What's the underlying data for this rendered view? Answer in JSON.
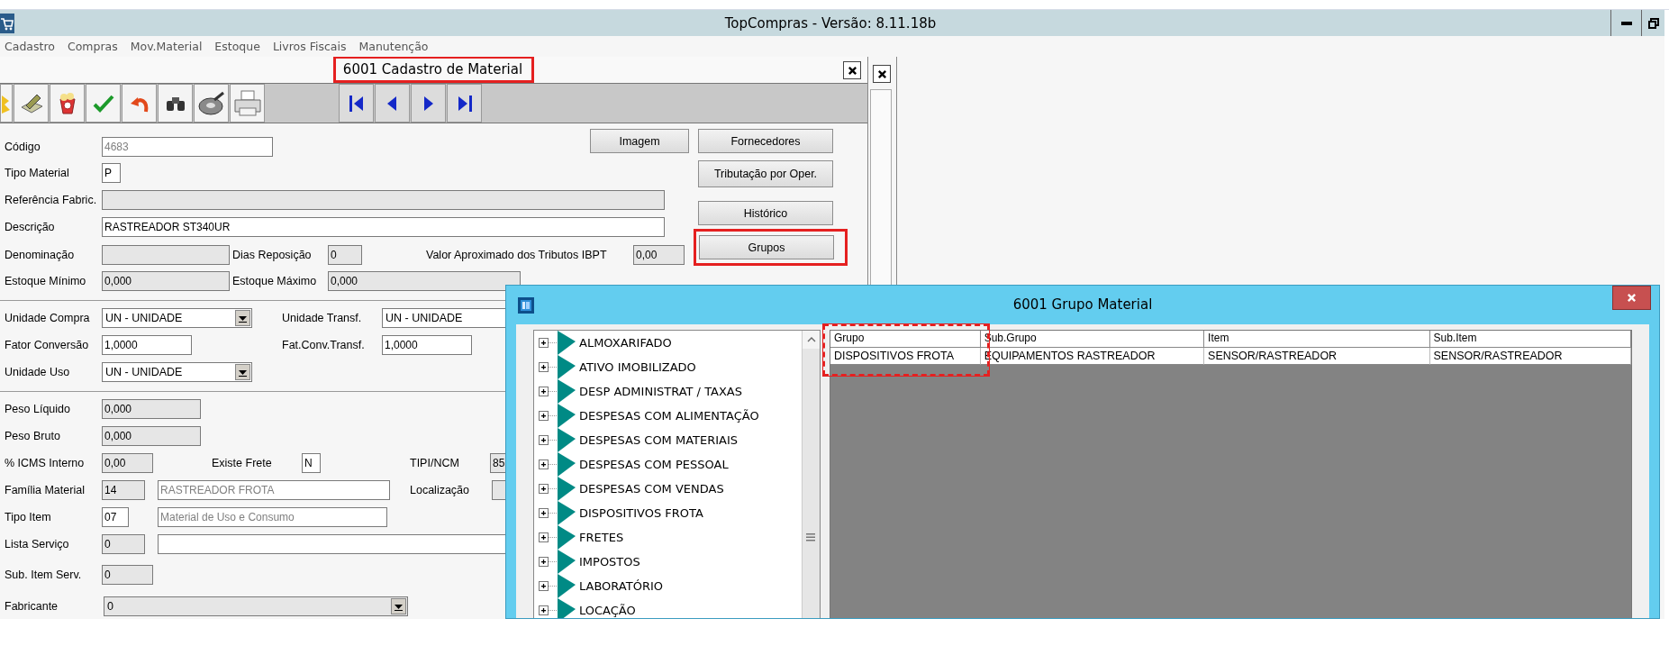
{
  "app": {
    "title": "TopCompras - Versão: 8.11.18b"
  },
  "menu": [
    "Cadastro",
    "Compras",
    "Mov.Material",
    "Estoque",
    "Livros Fiscais",
    "Manutenção"
  ],
  "material_window": {
    "title": "6001 Cadastro de Material",
    "title_highlighted": true,
    "toolbar": [
      {
        "kind": "sparkle"
      },
      {
        "kind": "edit"
      },
      {
        "kind": "basket"
      },
      {
        "kind": "confirm"
      },
      {
        "kind": "undo"
      },
      {
        "kind": "search"
      },
      {
        "kind": "disc"
      },
      {
        "kind": "print"
      }
    ],
    "navigation": [
      {
        "kind": "first"
      },
      {
        "kind": "previous"
      },
      {
        "kind": "next"
      },
      {
        "kind": "last"
      }
    ],
    "buttons": [
      {
        "label": "Imagem",
        "highlighted": false
      },
      {
        "label": "Fornecedores",
        "highlighted": false
      },
      {
        "label": "Tributação por Oper.",
        "highlighted": false
      },
      {
        "label": "Histórico",
        "highlighted": false
      },
      {
        "label": "Grupos",
        "highlighted": true
      }
    ],
    "rows": [
      {
        "kind": "fields",
        "items": [
          {
            "kind": "label",
            "text": "Código"
          },
          {
            "kind": "field",
            "value": "4683",
            "readonly": false,
            "dimmed": true
          }
        ]
      },
      {
        "kind": "fields",
        "items": [
          {
            "kind": "label",
            "text": "Tipo Material"
          },
          {
            "kind": "field",
            "value": "P",
            "readonly": false,
            "dimmed": false
          }
        ]
      },
      {
        "kind": "fields",
        "items": [
          {
            "kind": "label",
            "text": "Referência Fabric."
          },
          {
            "kind": "field",
            "readonly": true
          }
        ]
      },
      {
        "kind": "fields",
        "items": [
          {
            "kind": "label",
            "text": "Descrição"
          },
          {
            "kind": "field",
            "value": "RASTREADOR ST340UR",
            "readonly": false,
            "dimmed": false
          }
        ]
      },
      {
        "kind": "fields",
        "items": [
          {
            "kind": "label",
            "text": "Denominação"
          },
          {
            "kind": "field",
            "readonly": true
          },
          {
            "kind": "label",
            "text": "Dias Reposição"
          },
          {
            "kind": "field",
            "value": "0",
            "readonly": true,
            "dimmed": false
          },
          {
            "kind": "label",
            "text": "Valor Aproximado dos Tributos IBPT"
          },
          {
            "kind": "field",
            "value": "0,00",
            "readonly": true,
            "dimmed": false
          }
        ]
      },
      {
        "kind": "fields",
        "items": [
          {
            "kind": "label",
            "text": "Estoque Mínimo"
          },
          {
            "kind": "field",
            "value": "0,000",
            "readonly": true,
            "dimmed": false
          },
          {
            "kind": "label",
            "text": "Estoque Máximo"
          },
          {
            "kind": "field",
            "value": "0,000",
            "readonly": true,
            "dimmed": false
          }
        ]
      },
      {
        "kind": "divider"
      },
      {
        "kind": "fields",
        "items": [
          {
            "kind": "label",
            "text": "Unidade Compra"
          },
          {
            "kind": "dropdown",
            "value": "UN - UNIDADE",
            "readonly": false,
            "dimmed": false
          },
          {
            "kind": "label",
            "text": "Unidade Transf."
          },
          {
            "kind": "dropdown",
            "value": "UN - UNIDADE",
            "readonly": false,
            "dimmed": false
          }
        ]
      },
      {
        "kind": "fields",
        "items": [
          {
            "kind": "label",
            "text": "Fator Conversão"
          },
          {
            "kind": "field",
            "value": "1,0000",
            "readonly": false,
            "dimmed": false
          },
          {
            "kind": "label",
            "text": "Fat.Conv.Transf."
          },
          {
            "kind": "field",
            "value": "1,0000",
            "readonly": false,
            "dimmed": false
          }
        ]
      },
      {
        "kind": "fields",
        "items": [
          {
            "kind": "label",
            "text": "Unidade Uso"
          },
          {
            "kind": "dropdown",
            "value": "UN - UNIDADE",
            "readonly": false,
            "dimmed": false
          }
        ]
      },
      {
        "kind": "divider"
      },
      {
        "kind": "fields",
        "items": [
          {
            "kind": "label",
            "text": "Peso Líquido"
          },
          {
            "kind": "field",
            "value": "0,000",
            "readonly": true,
            "dimmed": false
          }
        ]
      },
      {
        "kind": "fields",
        "items": [
          {
            "kind": "label",
            "text": "Peso Bruto"
          },
          {
            "kind": "field",
            "value": "0,000",
            "readonly": true,
            "dimmed": false
          }
        ]
      },
      {
        "kind": "fields",
        "items": [
          {
            "kind": "label",
            "text": "% ICMS Interno"
          },
          {
            "kind": "field",
            "value": "0,00",
            "readonly": true,
            "dimmed": false
          },
          {
            "kind": "label",
            "text": "Existe Frete"
          },
          {
            "kind": "field",
            "value": "N",
            "readonly": false,
            "dimmed": false
          },
          {
            "kind": "label",
            "text": "TIPI/NCM"
          },
          {
            "kind": "field",
            "value": "85",
            "readonly": true,
            "dimmed": false
          }
        ]
      },
      {
        "kind": "fields",
        "items": [
          {
            "kind": "label",
            "text": "Família Material"
          },
          {
            "kind": "field",
            "value": "14",
            "readonly": true,
            "dimmed": false
          },
          {
            "kind": "field",
            "value": "RASTREADOR FROTA",
            "readonly": false,
            "dimmed": true
          },
          {
            "kind": "label",
            "text": "Localização"
          },
          {
            "kind": "field",
            "readonly": true
          }
        ]
      },
      {
        "kind": "fields",
        "items": [
          {
            "kind": "label",
            "text": "Tipo Item"
          },
          {
            "kind": "field",
            "value": "07",
            "readonly": false,
            "dimmed": false
          },
          {
            "kind": "field",
            "value": "Material de Uso e Consumo",
            "readonly": false,
            "dimmed": true
          }
        ]
      },
      {
        "kind": "fields",
        "items": [
          {
            "kind": "label",
            "text": "Lista Serviço"
          },
          {
            "kind": "field",
            "value": "0",
            "readonly": true,
            "dimmed": false
          },
          {
            "kind": "field",
            "readonly": false
          }
        ]
      },
      {
        "kind": "fields",
        "items": [
          {
            "kind": "label",
            "text": "Sub. Item Serv."
          },
          {
            "kind": "field",
            "value": "0",
            "readonly": true,
            "dimmed": false
          }
        ]
      },
      {
        "kind": "fields",
        "items": [
          {
            "kind": "label",
            "text": "Fabricante"
          },
          {
            "kind": "dropdown",
            "value": "0",
            "readonly": true,
            "dimmed": false
          }
        ]
      }
    ]
  },
  "group_dialog": {
    "title": "6001 Grupo Material",
    "tree": [
      {
        "label": "ALMOXARIFADO",
        "expanded": false
      },
      {
        "label": "ATIVO IMOBILIZADO",
        "expanded": false
      },
      {
        "label": "DESP ADMINISTRAT / TAXAS",
        "expanded": false
      },
      {
        "label": "DESPESAS COM ALIMENTAÇÃO",
        "expanded": false
      },
      {
        "label": "DESPESAS COM MATERIAIS",
        "expanded": false
      },
      {
        "label": "DESPESAS COM PESSOAL",
        "expanded": false
      },
      {
        "label": "DESPESAS COM VENDAS",
        "expanded": false
      },
      {
        "label": "DISPOSITIVOS FROTA",
        "expanded": false
      },
      {
        "label": "FRETES",
        "expanded": false
      },
      {
        "label": "IMPOSTOS",
        "expanded": false
      },
      {
        "label": "LABORATÓRIO",
        "expanded": false
      },
      {
        "label": "LOCAÇÃO",
        "expanded": false
      }
    ],
    "table": {
      "columns": [
        {
          "label": "Grupo",
          "highlighted": true
        },
        {
          "label": "Sub.Grupo",
          "highlighted": false
        },
        {
          "label": "Item",
          "highlighted": false
        },
        {
          "label": "Sub.Item",
          "highlighted": false
        }
      ],
      "rows": [
        [
          "DISPOSITIVOS FROTA",
          "EQUIPAMENTOS RASTREADOR",
          "SENSOR/RASTREADOR",
          "SENSOR/RASTREADOR"
        ]
      ]
    }
  }
}
